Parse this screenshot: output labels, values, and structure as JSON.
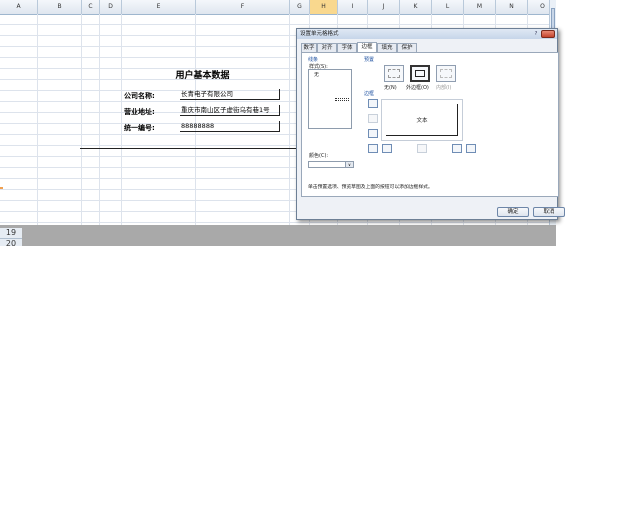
{
  "columns": [
    "A",
    "B",
    "C",
    "D",
    "E",
    "F",
    "G",
    "H",
    "I",
    "J",
    "K",
    "L",
    "M",
    "N",
    "O",
    "P"
  ],
  "selected_column": "H",
  "sheet": {
    "title": "用户基本数据",
    "rows": [
      {
        "label": "公司名称:",
        "value": "长青电子有限公司"
      },
      {
        "label": "营业地址:",
        "value": "重庆市南山区子虚街乌有巷1号"
      },
      {
        "label": "统一编号:",
        "value": "88888888"
      }
    ],
    "row_numbers": [
      "19",
      "20"
    ]
  },
  "dialog": {
    "title": "设置单元格格式",
    "help_icon": "?",
    "tabs": [
      "数字",
      "对齐",
      "字体",
      "边框",
      "填充",
      "保护"
    ],
    "active_tab": "边框",
    "line_group": "线条",
    "style_label": "样式(S):",
    "style_none": "无",
    "color_label": "颜色(C):",
    "color_dropdown_arrow": "∨",
    "presets_group": "预置",
    "presets": [
      {
        "label": "无(N)"
      },
      {
        "label": "外边框(O)"
      },
      {
        "label": "内部(I)"
      }
    ],
    "border_group": "边框",
    "preview_text": "文本",
    "hint": "单击预置选项、预览草图及上面的按钮可以添加边框样式。",
    "ok_label": "确定",
    "cancel_label": "取消"
  },
  "colors": {
    "accent": "#1c4fa0",
    "selected_header": "#f9d88e",
    "bottom_bar": "#a9a9a9"
  }
}
